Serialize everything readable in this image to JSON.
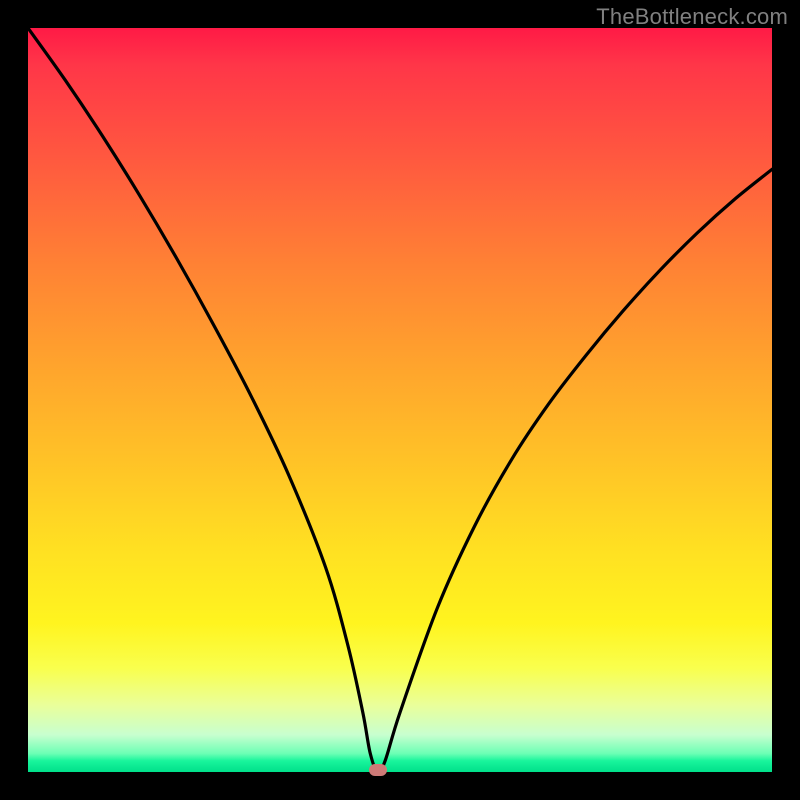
{
  "watermark": "TheBottleneck.com",
  "colors": {
    "frame": "#000000",
    "curve_stroke": "#000000",
    "dot_fill": "#cd7a77",
    "gradient_top": "#ff1a46",
    "gradient_bottom": "#00e08a"
  },
  "chart_data": {
    "type": "line",
    "title": "",
    "xlabel": "",
    "ylabel": "",
    "xlim": [
      0,
      100
    ],
    "ylim": [
      0,
      100
    ],
    "minimum_point": {
      "x": 47,
      "y": 0
    },
    "series": [
      {
        "name": "bottleneck-curve",
        "x": [
          0,
          5,
          10,
          15,
          20,
          25,
          30,
          35,
          40,
          43,
          45,
          46,
          47,
          48,
          50,
          55,
          60,
          65,
          70,
          75,
          80,
          85,
          90,
          95,
          100
        ],
        "y": [
          100,
          93,
          85.5,
          77.5,
          69,
          60,
          50.5,
          40,
          27.5,
          17,
          8,
          2.5,
          0,
          1.5,
          8,
          22,
          33,
          42,
          49.5,
          56,
          62,
          67.5,
          72.5,
          77,
          81
        ]
      }
    ],
    "annotations": []
  }
}
